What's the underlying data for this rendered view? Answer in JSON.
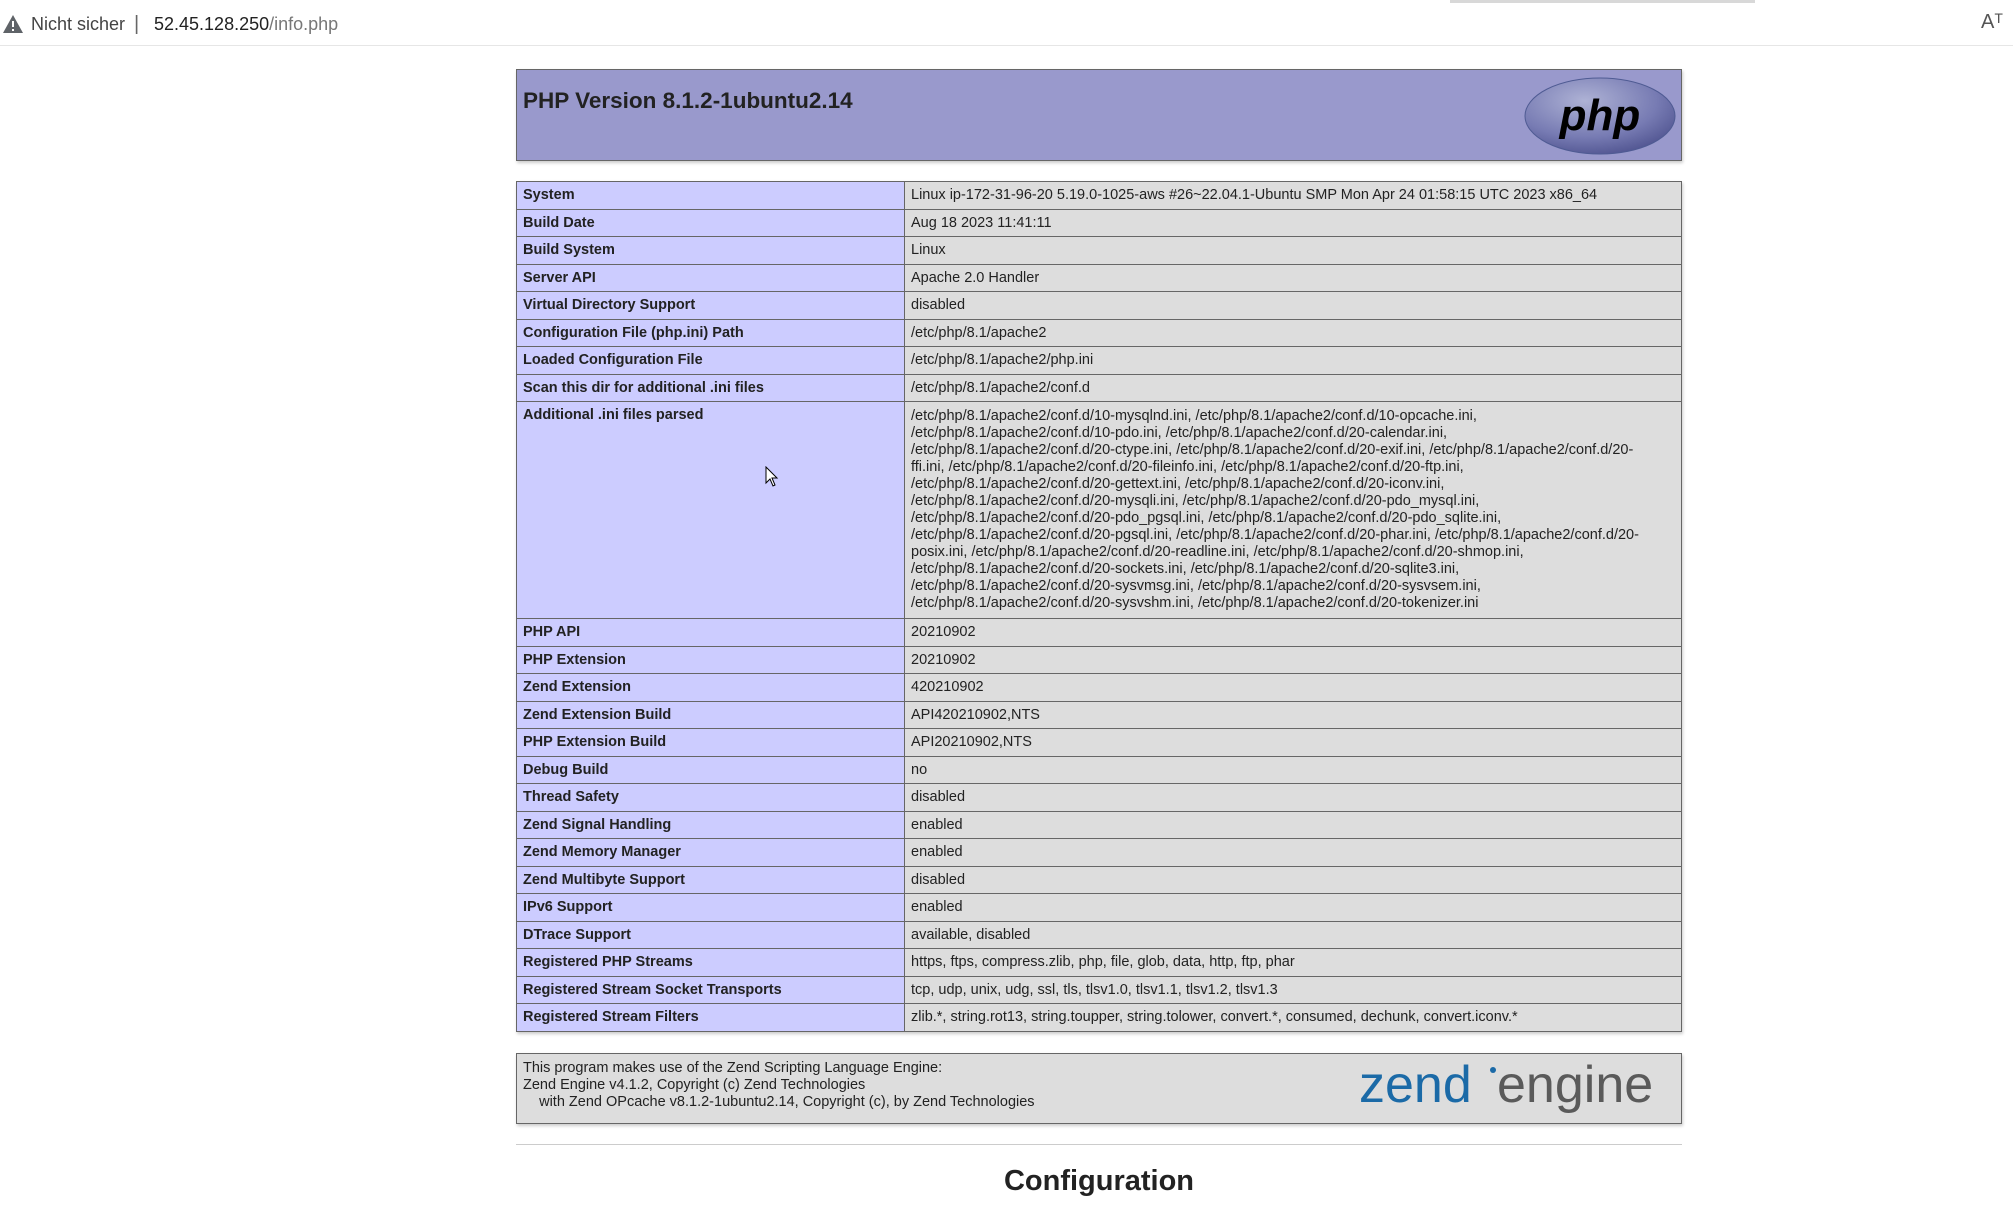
{
  "browser": {
    "insecure_label": "Nicht sicher",
    "separator": "|",
    "url_host": "52.45.128.250",
    "url_path": "/info.php",
    "reader_icon": "Aᵀ",
    "reader_icon_name": "reader-mode-icon"
  },
  "header": {
    "title": "PHP Version 8.1.2-1ubuntu2.14",
    "logo_text": "php"
  },
  "info_rows": [
    {
      "key": "System",
      "value": "Linux ip-172-31-96-20 5.19.0-1025-aws #26~22.04.1-Ubuntu SMP Mon Apr 24 01:58:15 UTC 2023 x86_64"
    },
    {
      "key": "Build Date",
      "value": "Aug 18 2023 11:41:11"
    },
    {
      "key": "Build System",
      "value": "Linux"
    },
    {
      "key": "Server API",
      "value": "Apache 2.0 Handler"
    },
    {
      "key": "Virtual Directory Support",
      "value": "disabled"
    },
    {
      "key": "Configuration File (php.ini) Path",
      "value": "/etc/php/8.1/apache2"
    },
    {
      "key": "Loaded Configuration File",
      "value": "/etc/php/8.1/apache2/php.ini"
    },
    {
      "key": "Scan this dir for additional .ini files",
      "value": "/etc/php/8.1/apache2/conf.d"
    },
    {
      "key": "Additional .ini files parsed",
      "lines": [
        "/etc/php/8.1/apache2/conf.d/10-mysqlnd.ini, /etc/php/8.1/apache2/conf.d/10-opcache.ini,",
        "/etc/php/8.1/apache2/conf.d/10-pdo.ini, /etc/php/8.1/apache2/conf.d/20-calendar.ini,",
        "/etc/php/8.1/apache2/conf.d/20-ctype.ini, /etc/php/8.1/apache2/conf.d/20-exif.ini, /etc/php/8.1/apache2/conf.d/20-",
        "ffi.ini, /etc/php/8.1/apache2/conf.d/20-fileinfo.ini, /etc/php/8.1/apache2/conf.d/20-ftp.ini,",
        "/etc/php/8.1/apache2/conf.d/20-gettext.ini, /etc/php/8.1/apache2/conf.d/20-iconv.ini,",
        "/etc/php/8.1/apache2/conf.d/20-mysqli.ini, /etc/php/8.1/apache2/conf.d/20-pdo_mysql.ini,",
        "/etc/php/8.1/apache2/conf.d/20-pdo_pgsql.ini, /etc/php/8.1/apache2/conf.d/20-pdo_sqlite.ini,",
        "/etc/php/8.1/apache2/conf.d/20-pgsql.ini, /etc/php/8.1/apache2/conf.d/20-phar.ini, /etc/php/8.1/apache2/conf.d/20-",
        "posix.ini, /etc/php/8.1/apache2/conf.d/20-readline.ini, /etc/php/8.1/apache2/conf.d/20-shmop.ini,",
        "/etc/php/8.1/apache2/conf.d/20-sockets.ini, /etc/php/8.1/apache2/conf.d/20-sqlite3.ini,",
        "/etc/php/8.1/apache2/conf.d/20-sysvmsg.ini, /etc/php/8.1/apache2/conf.d/20-sysvsem.ini,",
        "/etc/php/8.1/apache2/conf.d/20-sysvshm.ini, /etc/php/8.1/apache2/conf.d/20-tokenizer.ini"
      ]
    },
    {
      "key": "PHP API",
      "value": "20210902"
    },
    {
      "key": "PHP Extension",
      "value": "20210902"
    },
    {
      "key": "Zend Extension",
      "value": "420210902"
    },
    {
      "key": "Zend Extension Build",
      "value": "API420210902,NTS"
    },
    {
      "key": "PHP Extension Build",
      "value": "API20210902,NTS"
    },
    {
      "key": "Debug Build",
      "value": "no"
    },
    {
      "key": "Thread Safety",
      "value": "disabled"
    },
    {
      "key": "Zend Signal Handling",
      "value": "enabled"
    },
    {
      "key": "Zend Memory Manager",
      "value": "enabled"
    },
    {
      "key": "Zend Multibyte Support",
      "value": "disabled"
    },
    {
      "key": "IPv6 Support",
      "value": "enabled"
    },
    {
      "key": "DTrace Support",
      "value": "available, disabled"
    },
    {
      "key": "Registered PHP Streams",
      "value": "https, ftps, compress.zlib, php, file, glob, data, http, ftp, phar"
    },
    {
      "key": "Registered Stream Socket Transports",
      "value": "tcp, udp, unix, udg, ssl, tls, tlsv1.0, tlsv1.1, tlsv1.2, tlsv1.3"
    },
    {
      "key": "Registered Stream Filters",
      "value": "zlib.*, string.rot13, string.toupper, string.tolower, convert.*, consumed, dechunk, convert.iconv.*"
    }
  ],
  "zend": {
    "line1": "This program makes use of the Zend Scripting Language Engine:",
    "line2": "Zend Engine v4.1.2, Copyright (c) Zend Technologies",
    "line3": "    with Zend OPcache v8.1.2-1ubuntu2.14, Copyright (c), by Zend Technologies",
    "logo_zend": "zend",
    "logo_engine": "engine"
  },
  "section": {
    "title": "Configuration"
  },
  "colors": {
    "header_bg": "#9999cc",
    "key_bg": "#ccccff",
    "value_bg": "#dddddd",
    "border": "#666666"
  }
}
